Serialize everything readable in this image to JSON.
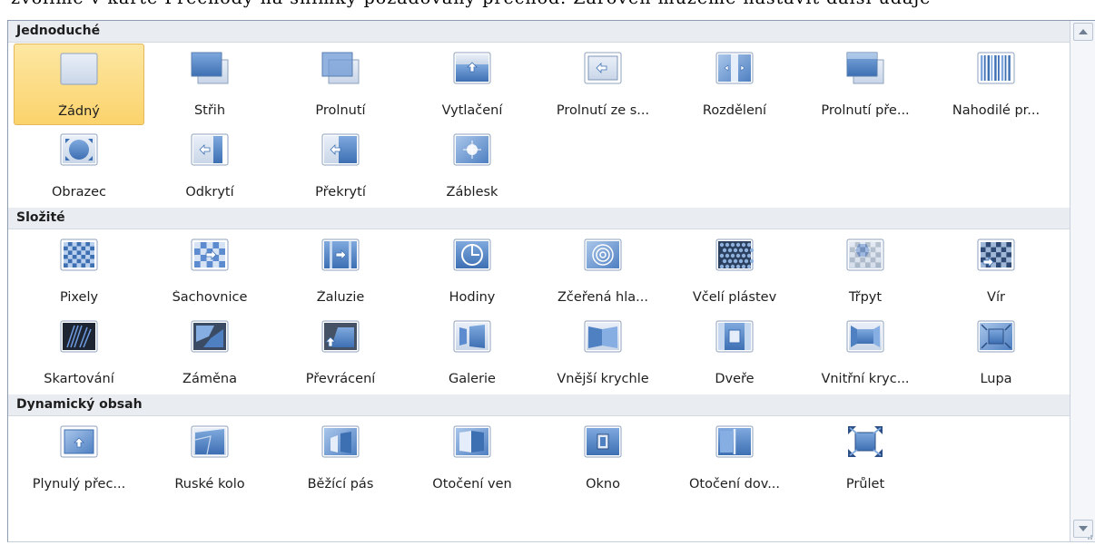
{
  "top_text": "zvolíme v kartě Přechody na snímky požadovaný přechod. Zároveň můžeme nastavit další údaje",
  "categories": [
    {
      "name": "Jednoduché",
      "items": [
        {
          "label": "Žádný",
          "icon": "none-transition-icon",
          "selected": true
        },
        {
          "label": "Střih",
          "icon": "cut-transition-icon"
        },
        {
          "label": "Prolnutí",
          "icon": "fade-transition-icon"
        },
        {
          "label": "Vytlačení",
          "icon": "push-transition-icon"
        },
        {
          "label": "Prolnutí ze s...",
          "icon": "wipe-transition-icon"
        },
        {
          "label": "Rozdělení",
          "icon": "split-transition-icon"
        },
        {
          "label": "Prolnutí pře...",
          "icon": "reveal-transition-icon"
        },
        {
          "label": "Nahodilé pr...",
          "icon": "random-bars-transition-icon"
        },
        {
          "label": "Obrazec",
          "icon": "shape-transition-icon"
        },
        {
          "label": "Odkrytí",
          "icon": "uncover-transition-icon"
        },
        {
          "label": "Překrytí",
          "icon": "cover-transition-icon"
        },
        {
          "label": "Záblesk",
          "icon": "flash-transition-icon"
        }
      ]
    },
    {
      "name": "Složité",
      "items": [
        {
          "label": "Pixely",
          "icon": "dissolve-transition-icon"
        },
        {
          "label": "Šachovnice",
          "icon": "checkerboard-transition-icon"
        },
        {
          "label": "Žaluzie",
          "icon": "blinds-transition-icon"
        },
        {
          "label": "Hodiny",
          "icon": "clock-transition-icon"
        },
        {
          "label": "Zčeřená hla...",
          "icon": "ripple-transition-icon"
        },
        {
          "label": "Včelí plástev",
          "icon": "honeycomb-transition-icon"
        },
        {
          "label": "Třpyt",
          "icon": "glitter-transition-icon"
        },
        {
          "label": "Vír",
          "icon": "vortex-transition-icon"
        },
        {
          "label": "Skartování",
          "icon": "shred-transition-icon"
        },
        {
          "label": "Záměna",
          "icon": "switch-transition-icon"
        },
        {
          "label": "Převrácení",
          "icon": "flip-transition-icon"
        },
        {
          "label": "Galerie",
          "icon": "gallery-transition-icon"
        },
        {
          "label": "Vnější krychle",
          "icon": "cube-transition-icon"
        },
        {
          "label": "Dveře",
          "icon": "doors-transition-icon"
        },
        {
          "label": "Vnitřní kryc...",
          "icon": "box-transition-icon"
        },
        {
          "label": "Lupa",
          "icon": "zoom-transition-icon"
        }
      ]
    },
    {
      "name": "Dynamický obsah",
      "items": [
        {
          "label": "Plynulý přec...",
          "icon": "pan-transition-icon"
        },
        {
          "label": "Ruské kolo",
          "icon": "ferris-wheel-transition-icon"
        },
        {
          "label": "Běžící pás",
          "icon": "conveyor-transition-icon"
        },
        {
          "label": "Otočení ven",
          "icon": "rotate-transition-icon"
        },
        {
          "label": "Okno",
          "icon": "window-transition-icon"
        },
        {
          "label": "Otočení dov...",
          "icon": "orbit-transition-icon"
        },
        {
          "label": "Průlet",
          "icon": "fly-through-transition-icon"
        }
      ]
    }
  ]
}
